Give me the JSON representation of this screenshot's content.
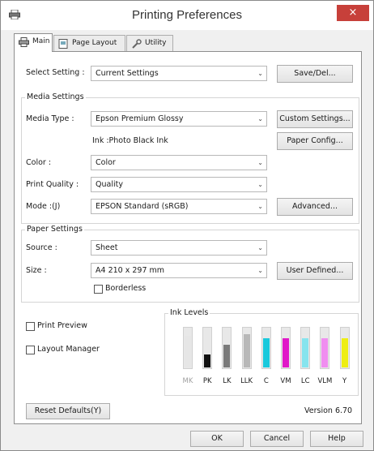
{
  "window": {
    "title": "Printing Preferences",
    "close_glyph": "×"
  },
  "tabs": [
    {
      "label": "Main",
      "icon": "printer-icon",
      "active": true
    },
    {
      "label": "Page Layout",
      "icon": "page-layout-icon",
      "active": false
    },
    {
      "label": "Utility",
      "icon": "wrench-icon",
      "active": false
    }
  ],
  "select_setting": {
    "label": "Select Setting :",
    "value": "Current Settings",
    "save_button": "Save/Del..."
  },
  "media_settings": {
    "group_title": "Media Settings",
    "media_type_label": "Media Type :",
    "media_type_value": "Epson Premium Glossy",
    "custom_settings_button": "Custom Settings...",
    "ink_text": "Ink :Photo Black Ink",
    "paper_config_button": "Paper Config...",
    "color_label": "Color :",
    "color_value": "Color",
    "print_quality_label": "Print Quality :",
    "print_quality_value": "Quality",
    "mode_label": "Mode :(J)",
    "mode_value": "EPSON Standard (sRGB)",
    "advanced_button": "Advanced..."
  },
  "paper_settings": {
    "group_title": "Paper Settings",
    "source_label": "Source :",
    "source_value": "Sheet",
    "size_label": "Size :",
    "size_value": "A4 210 x 297 mm",
    "user_defined_button": "User Defined...",
    "borderless_label": "Borderless",
    "borderless_checked": false
  },
  "options": {
    "print_preview_label": "Print Preview",
    "print_preview_checked": false,
    "layout_manager_label": "Layout Manager",
    "layout_manager_checked": false
  },
  "ink_levels": {
    "group_title": "Ink Levels",
    "inks": [
      {
        "name": "MK",
        "level": 0.78,
        "color": "#e6e6e6",
        "muted": true
      },
      {
        "name": "PK",
        "level": 0.32,
        "color": "#111111",
        "muted": false
      },
      {
        "name": "LK",
        "level": 0.55,
        "color": "#7a7a7a",
        "muted": false
      },
      {
        "name": "LLK",
        "level": 0.82,
        "color": "#b8b8b8",
        "muted": false
      },
      {
        "name": "C",
        "level": 0.72,
        "color": "#19c9dc",
        "muted": false
      },
      {
        "name": "VM",
        "level": 0.72,
        "color": "#e018c8",
        "muted": false
      },
      {
        "name": "LC",
        "level": 0.72,
        "color": "#86e4ee",
        "muted": false
      },
      {
        "name": "VLM",
        "level": 0.72,
        "color": "#f08ef0",
        "muted": false
      },
      {
        "name": "Y",
        "level": 0.72,
        "color": "#eeee12",
        "muted": false
      }
    ]
  },
  "footer": {
    "reset_button": "Reset Defaults(Y)",
    "version": "Version 6.70",
    "ok_button": "OK",
    "cancel_button": "Cancel",
    "help_button": "Help"
  }
}
